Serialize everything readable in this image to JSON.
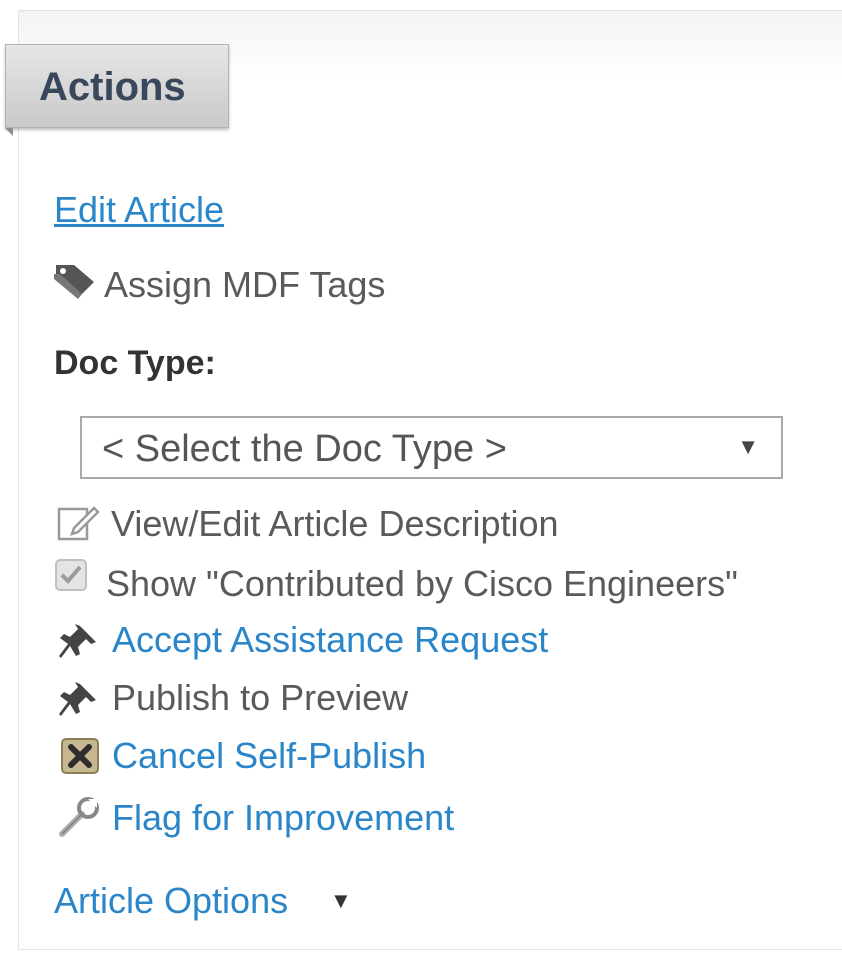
{
  "panel": {
    "title": "Actions"
  },
  "actions": {
    "edit_article": "Edit Article",
    "assign_mdf_tags": "Assign MDF Tags",
    "doc_type_label": "Doc Type:",
    "doc_type_select": {
      "selected": "< Select the Doc Type >",
      "arrow": "▼"
    },
    "view_edit_description": "View/Edit Article Description",
    "show_contributed": "Show \"Contributed by Cisco Engineers\"",
    "show_contributed_checked": true,
    "accept_assistance": "Accept Assistance Request",
    "publish_preview": "Publish to Preview",
    "cancel_self_publish": "Cancel Self-Publish",
    "flag_improvement": "Flag for Improvement",
    "article_options": "Article Options",
    "article_options_arrow": "▼"
  },
  "colors": {
    "link": "#2a86c8",
    "text_gray": "#5a5a5a",
    "title": "#39475a"
  },
  "icons": {
    "assign_tags": "tags-icon",
    "view_edit": "edit-note-icon",
    "checkbox": "checkbox-checked-icon",
    "accept": "pin-icon",
    "publish": "pin-icon",
    "cancel": "cancel-x-box-icon",
    "flag": "wrench-icon",
    "dropdown": "caret-down-icon"
  }
}
